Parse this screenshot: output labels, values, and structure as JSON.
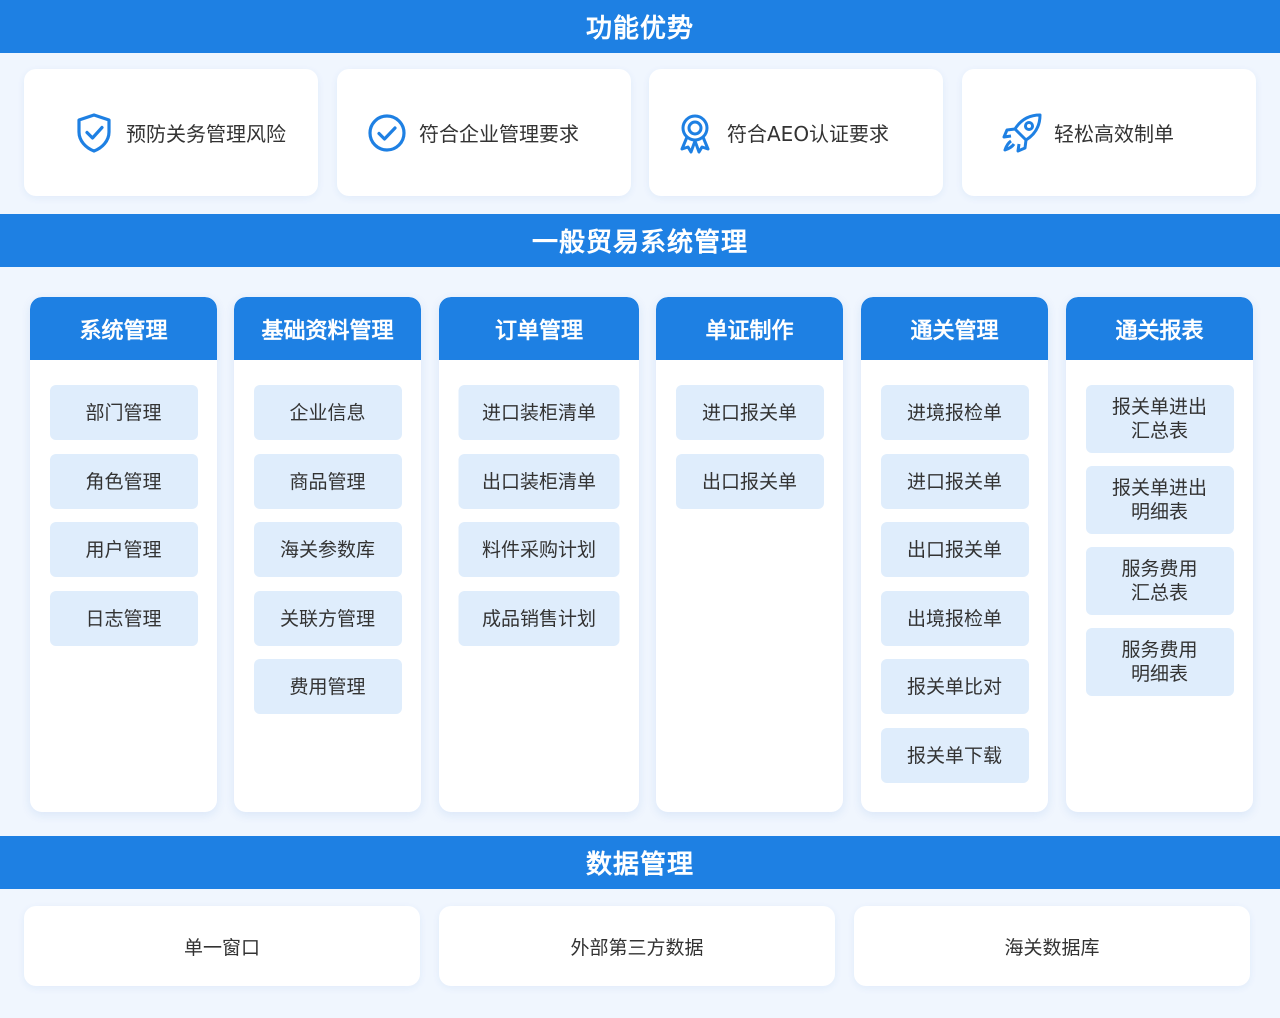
{
  "section_features": {
    "title": "功能优势",
    "items": [
      {
        "label": "预防关务管理风险",
        "icon": "shield-check-icon"
      },
      {
        "label": "符合企业管理要求",
        "icon": "check-circle-icon"
      },
      {
        "label": "符合AEO认证要求",
        "icon": "award-ribbon-icon"
      },
      {
        "label": "轻松高效制单",
        "icon": "rocket-icon"
      }
    ]
  },
  "section_system": {
    "title": "一般贸易系统管理",
    "columns": [
      {
        "title": "系统管理",
        "items": [
          "部门管理",
          "角色管理",
          "用户管理",
          "日志管理"
        ]
      },
      {
        "title": "基础资料管理",
        "items": [
          "企业信息",
          "商品管理",
          "海关参数库",
          "关联方管理",
          "费用管理"
        ]
      },
      {
        "title": "订单管理",
        "items": [
          "进口装柜清单",
          "出口装柜清单",
          "料件采购计划",
          "成品销售计划"
        ]
      },
      {
        "title": "单证制作",
        "items": [
          "进口报关单",
          "出口报关单"
        ]
      },
      {
        "title": "通关管理",
        "items": [
          "进境报检单",
          "进口报关单",
          "出口报关单",
          "出境报检单",
          "报关单比对",
          "报关单下载"
        ]
      },
      {
        "title": "通关报表",
        "items": [
          [
            "报关单进出",
            "汇总表"
          ],
          [
            "报关单进出",
            "明细表"
          ],
          [
            "服务费用",
            "汇总表"
          ],
          [
            "服务费用",
            "明细表"
          ]
        ]
      }
    ]
  },
  "section_data": {
    "title": "数据管理",
    "items": [
      "单一窗口",
      "外部第三方数据",
      "海关数据库"
    ]
  },
  "colors": {
    "accent": "#1e80e3",
    "item_bg": "#dfedfc",
    "page_bg": "#f0f6fe"
  }
}
